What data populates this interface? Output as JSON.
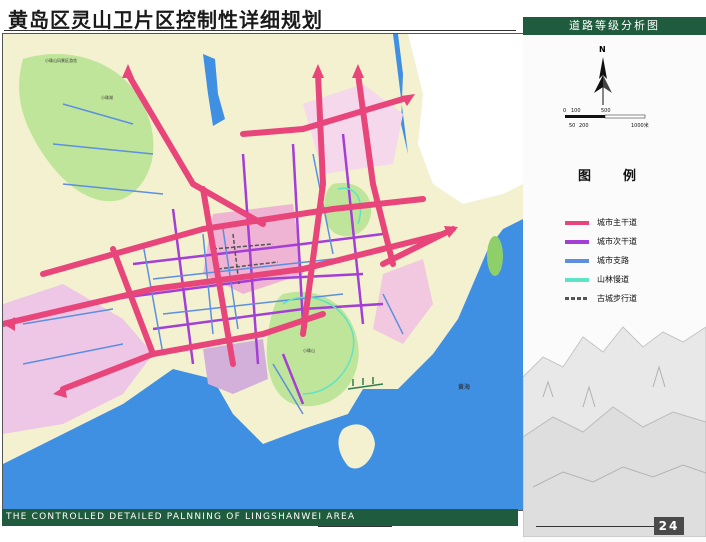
{
  "title": "黄岛区灵山卫片区控制性详细规划",
  "panel_title": "道路等级分析图",
  "north_label": "N",
  "scale": {
    "ticks": [
      "0",
      "100",
      "500",
      "50",
      "200",
      "1000米"
    ]
  },
  "legend": {
    "title_left": "图",
    "title_right": "例",
    "items": [
      {
        "label": "城市主干道",
        "color": "#e8457a"
      },
      {
        "label": "城市次干道",
        "color": "#a43fd6"
      },
      {
        "label": "城市支路",
        "color": "#5d8fe0"
      },
      {
        "label": "山林慢道",
        "color": "#5fe3c6"
      },
      {
        "label": "古城步行道",
        "color": "#555555"
      }
    ]
  },
  "map_labels": {
    "sea": "黄海",
    "reservoir": "小珠山风景区游览",
    "lake": "小珠湖",
    "hill": "小珠山"
  },
  "footer": "THE CONTROLLED DETAILED PALNNING OF LINGSHANWEI AREA",
  "page_number": "24"
}
